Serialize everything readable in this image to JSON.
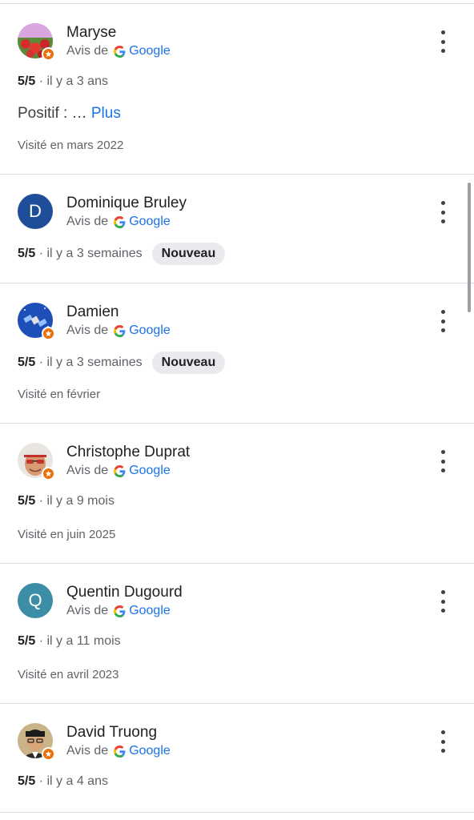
{
  "source_label": "Avis de",
  "google_label": "Google",
  "reviews": [
    {
      "name": "Maryse",
      "rating": "5/5",
      "time": "· il y a 3 ans",
      "text": "Positif : …",
      "more": "Plus",
      "visited": "Visité en mars 2022",
      "avatar": "photo-flowers",
      "local_guide": true
    },
    {
      "name": "Dominique Bruley",
      "rating": "5/5",
      "time": "· il y a 3 semaines",
      "tag": "Nouveau",
      "avatar_letter": "D",
      "avatar_color": "#1f4e99",
      "local_guide": false
    },
    {
      "name": "Damien",
      "rating": "5/5",
      "time": "· il y a 3 semaines",
      "tag": "Nouveau",
      "visited": "Visité en février",
      "avatar": "photo-satellite",
      "local_guide": true
    },
    {
      "name": "Christophe Duprat",
      "rating": "5/5",
      "time": "· il y a 9 mois",
      "visited": "Visité en juin 2025",
      "avatar": "photo-person-cap",
      "local_guide": true
    },
    {
      "name": "Quentin Dugourd",
      "rating": "5/5",
      "time": "· il y a 11 mois",
      "visited": "Visité en avril 2023",
      "avatar_letter": "Q",
      "avatar_color": "#3b8ea5",
      "local_guide": false
    },
    {
      "name": "David Truong",
      "rating": "5/5",
      "time": "· il y a 4 ans",
      "avatar": "photo-person-glasses",
      "local_guide": true
    }
  ],
  "icons": {
    "menu": "more-vert-icon",
    "badge": "local-guide-star-icon",
    "logo": "google-g-icon"
  }
}
